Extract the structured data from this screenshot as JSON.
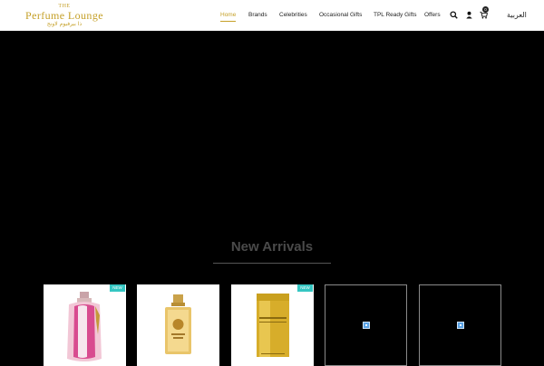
{
  "header": {
    "logo": {
      "top_line": "THE",
      "brand": "Perfume Lounge",
      "script_line": "ذا بيرفيوم لاونج"
    },
    "nav": [
      {
        "label": "Home",
        "active": true
      },
      {
        "label": "Brands",
        "active": false
      },
      {
        "label": "Celebrities",
        "active": false
      },
      {
        "label": "Occasional Gifts",
        "active": false
      },
      {
        "label": "TPL Ready Gifts",
        "active": false
      },
      {
        "label": "Offers",
        "active": false
      }
    ],
    "icons": [
      "search-icon",
      "user-icon",
      "cart-icon"
    ],
    "cart_count": "0",
    "language": "العربية"
  },
  "section": {
    "title": "New Arrivals"
  },
  "products": [
    {
      "badge": "NEW",
      "image": "pink-perfume-bottle"
    },
    {
      "badge": "",
      "image": "gold-perfume-bottle"
    },
    {
      "badge": "NEW",
      "image": "gold-box-bottle"
    },
    {
      "badge": "",
      "image": "broken-image-icon"
    },
    {
      "badge": "",
      "image": "broken-image-icon"
    }
  ],
  "colors": {
    "accent": "#c5a028",
    "badge": "#35c6c2",
    "background": "#000000"
  }
}
